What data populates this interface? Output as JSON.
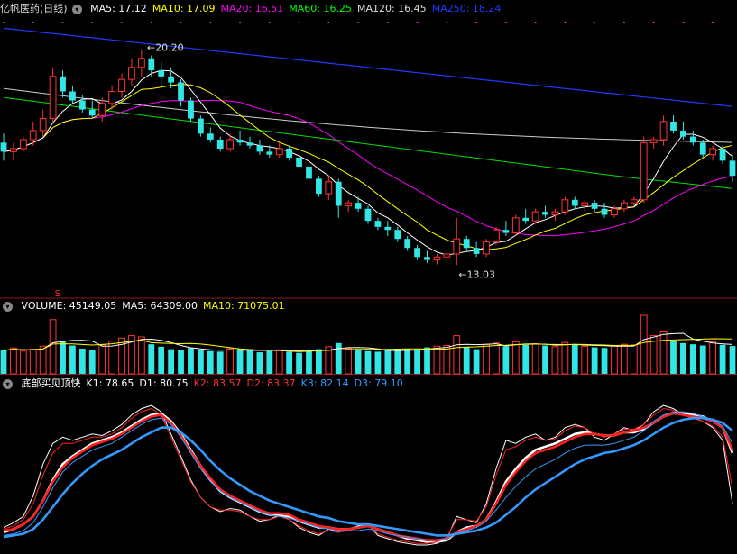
{
  "header1": {
    "title": "亿帆医药(日线)",
    "ma": [
      {
        "label": "MA5: 17.12",
        "color": "#ffffff"
      },
      {
        "label": "MA10: 17.09",
        "color": "#ffff00"
      },
      {
        "label": "MA20: 16.51",
        "color": "#ff00ff"
      },
      {
        "label": "MA60: 16.25",
        "color": "#00ff00"
      },
      {
        "label": "MA120: 16.45",
        "color": "#dddddd"
      },
      {
        "label": "MA250: 18.24",
        "color": "#1e3cff"
      }
    ]
  },
  "header2": {
    "items": [
      {
        "label": "VOLUME: 45149.05",
        "color": "#ffffff"
      },
      {
        "label": "MA5: 64309.00",
        "color": "#ffffff"
      },
      {
        "label": "MA10: 71075.01",
        "color": "#ffff00"
      }
    ]
  },
  "header3": {
    "items": [
      {
        "label": "底部买见顶快",
        "color": "#ffffff"
      },
      {
        "label": "K1: 78.65",
        "color": "#ffffff"
      },
      {
        "label": "D1: 80.75",
        "color": "#ffffff"
      },
      {
        "label": "K2: 83.57",
        "color": "#ff3333"
      },
      {
        "label": "D2: 83.37",
        "color": "#ff3333"
      },
      {
        "label": "K3: 82.14",
        "color": "#3399ff"
      },
      {
        "label": "D3: 79.10",
        "color": "#3399ff"
      }
    ]
  },
  "annotations": {
    "high": "20.20",
    "low": "13.03",
    "signal": "S"
  },
  "chart_data": {
    "type": "candlestick",
    "price_ylim": [
      12.2,
      21.3
    ],
    "bars": 75,
    "high_point": {
      "index": 14,
      "value": 20.2
    },
    "low_point": {
      "index": 46,
      "value": 13.03
    },
    "ohlc": [
      [
        17.1,
        17.4,
        16.5,
        16.8
      ],
      [
        16.8,
        17.1,
        16.5,
        16.9
      ],
      [
        16.9,
        17.3,
        16.8,
        17.2
      ],
      [
        17.2,
        17.8,
        17.0,
        17.5
      ],
      [
        17.5,
        18.2,
        17.3,
        17.9
      ],
      [
        17.9,
        19.6,
        17.8,
        19.3
      ],
      [
        19.3,
        19.5,
        18.6,
        18.8
      ],
      [
        18.8,
        19.0,
        18.4,
        18.5
      ],
      [
        18.5,
        18.7,
        18.1,
        18.2
      ],
      [
        18.2,
        18.5,
        17.9,
        18.0
      ],
      [
        18.0,
        18.6,
        17.8,
        18.4
      ],
      [
        18.4,
        19.0,
        18.2,
        18.8
      ],
      [
        18.8,
        19.4,
        18.6,
        19.2
      ],
      [
        19.2,
        19.9,
        19.0,
        19.6
      ],
      [
        19.6,
        20.2,
        19.3,
        19.9
      ],
      [
        19.9,
        20.0,
        19.3,
        19.5
      ],
      [
        19.5,
        19.8,
        19.0,
        19.3
      ],
      [
        19.3,
        19.6,
        18.9,
        19.1
      ],
      [
        19.1,
        19.2,
        18.3,
        18.5
      ],
      [
        18.5,
        18.6,
        17.8,
        17.9
      ],
      [
        17.9,
        18.0,
        17.3,
        17.4
      ],
      [
        17.4,
        17.6,
        17.1,
        17.2
      ],
      [
        17.2,
        17.3,
        16.8,
        16.9
      ],
      [
        16.9,
        17.4,
        16.8,
        17.2
      ],
      [
        17.2,
        17.5,
        17.0,
        17.1
      ],
      [
        17.1,
        17.3,
        16.9,
        17.0
      ],
      [
        17.0,
        17.2,
        16.7,
        16.8
      ],
      [
        16.8,
        17.0,
        16.6,
        16.7
      ],
      [
        16.7,
        17.1,
        16.6,
        16.9
      ],
      [
        16.9,
        17.0,
        16.5,
        16.6
      ],
      [
        16.6,
        16.7,
        16.2,
        16.3
      ],
      [
        16.3,
        16.4,
        15.8,
        15.9
      ],
      [
        15.9,
        16.0,
        15.3,
        15.4
      ],
      [
        15.4,
        16.0,
        15.2,
        15.8
      ],
      [
        15.8,
        15.9,
        14.6,
        15.0
      ],
      [
        15.0,
        15.2,
        14.8,
        15.1
      ],
      [
        15.1,
        15.3,
        14.8,
        14.9
      ],
      [
        14.9,
        15.0,
        14.4,
        14.5
      ],
      [
        14.5,
        14.6,
        14.2,
        14.3
      ],
      [
        14.3,
        14.5,
        14.0,
        14.2
      ],
      [
        14.2,
        14.3,
        13.8,
        13.9
      ],
      [
        13.9,
        14.0,
        13.5,
        13.6
      ],
      [
        13.6,
        13.7,
        13.2,
        13.3
      ],
      [
        13.3,
        13.5,
        13.1,
        13.2
      ],
      [
        13.2,
        13.4,
        13.05,
        13.3
      ],
      [
        13.3,
        13.5,
        13.1,
        13.4
      ],
      [
        13.4,
        14.6,
        13.03,
        13.9
      ],
      [
        13.9,
        14.0,
        13.5,
        13.6
      ],
      [
        13.6,
        13.8,
        13.3,
        13.4
      ],
      [
        13.4,
        13.9,
        13.3,
        13.8
      ],
      [
        13.8,
        14.3,
        13.7,
        14.2
      ],
      [
        14.2,
        14.5,
        14.0,
        14.1
      ],
      [
        14.1,
        14.7,
        14.0,
        14.6
      ],
      [
        14.6,
        14.9,
        14.4,
        14.5
      ],
      [
        14.5,
        14.9,
        14.4,
        14.8
      ],
      [
        14.8,
        15.0,
        14.6,
        14.7
      ],
      [
        14.7,
        14.9,
        14.5,
        14.8
      ],
      [
        14.8,
        15.3,
        14.7,
        15.2
      ],
      [
        15.2,
        15.3,
        14.9,
        15.0
      ],
      [
        15.0,
        15.2,
        14.8,
        15.1
      ],
      [
        15.1,
        15.2,
        14.8,
        14.9
      ],
      [
        14.9,
        15.1,
        14.6,
        14.7
      ],
      [
        14.7,
        15.0,
        14.6,
        14.9
      ],
      [
        14.9,
        15.2,
        14.8,
        15.1
      ],
      [
        15.1,
        15.3,
        15.0,
        15.2
      ],
      [
        15.2,
        17.3,
        15.1,
        17.1
      ],
      [
        17.1,
        17.3,
        16.9,
        17.2
      ],
      [
        17.2,
        18.0,
        17.0,
        17.8
      ],
      [
        17.8,
        18.0,
        17.4,
        17.5
      ],
      [
        17.5,
        17.8,
        17.2,
        17.3
      ],
      [
        17.3,
        17.5,
        17.0,
        17.1
      ],
      [
        17.1,
        17.2,
        16.6,
        16.7
      ],
      [
        16.7,
        17.0,
        16.5,
        16.9
      ],
      [
        16.9,
        17.0,
        16.4,
        16.5
      ],
      [
        16.5,
        16.7,
        15.8,
        16.0
      ]
    ],
    "volume_ylim": [
      0,
      95000
    ],
    "volume": [
      38000,
      42000,
      37000,
      40000,
      45000,
      88000,
      52000,
      46000,
      41000,
      39000,
      47000,
      53000,
      58000,
      62000,
      60000,
      48000,
      44000,
      40000,
      38000,
      42000,
      39000,
      37000,
      36000,
      41000,
      40000,
      38000,
      35000,
      37000,
      39000,
      36000,
      34000,
      38000,
      40000,
      44000,
      50000,
      41000,
      39000,
      37000,
      36000,
      38000,
      39000,
      41000,
      40000,
      43000,
      45000,
      46000,
      62000,
      44000,
      40000,
      48000,
      50000,
      45000,
      52000,
      47000,
      49000,
      46000,
      44000,
      51000,
      48000,
      45000,
      43000,
      42000,
      46000,
      48000,
      47000,
      95000,
      62000,
      68000,
      54000,
      50000,
      48000,
      46000,
      52000,
      47000,
      45149
    ],
    "kd_ylim": [
      0,
      100
    ],
    "series": [
      {
        "name": "K1",
        "color": "#ffffff",
        "values": [
          15,
          18,
          22,
          35,
          55,
          68,
          72,
          70,
          72,
          74,
          73,
          76,
          80,
          86,
          90,
          92,
          88,
          74,
          60,
          45,
          34,
          28,
          25,
          27,
          26,
          22,
          19,
          20,
          23,
          20,
          15,
          12,
          10,
          14,
          12,
          14,
          16,
          17,
          10,
          8,
          6,
          5,
          4,
          4,
          5,
          8,
          22,
          20,
          18,
          30,
          52,
          70,
          68,
          72,
          74,
          70,
          72,
          78,
          80,
          78,
          72,
          70,
          74,
          78,
          76,
          80,
          88,
          92,
          90,
          86,
          84,
          82,
          78,
          70,
          30
        ]
      },
      {
        "name": "D1",
        "color": "#ffffff",
        "values": [
          12,
          14,
          17,
          22,
          32,
          45,
          55,
          60,
          64,
          68,
          70,
          72,
          75,
          79,
          83,
          86,
          87,
          82,
          74,
          64,
          54,
          45,
          38,
          34,
          31,
          28,
          25,
          23,
          23,
          22,
          19,
          17,
          15,
          15,
          14,
          14,
          15,
          16,
          14,
          12,
          10,
          8,
          7,
          6,
          6,
          7,
          12,
          15,
          16,
          20,
          31,
          44,
          52,
          59,
          64,
          66,
          68,
          71,
          74,
          75,
          74,
          73,
          73,
          75,
          75,
          77,
          81,
          85,
          87,
          87,
          86,
          85,
          82,
          78,
          62
        ]
      },
      {
        "name": "K2",
        "color": "#ff2020",
        "values": [
          14,
          16,
          20,
          30,
          48,
          62,
          68,
          68,
          70,
          72,
          72,
          74,
          78,
          84,
          88,
          90,
          86,
          72,
          58,
          44,
          34,
          28,
          26,
          26,
          25,
          22,
          20,
          20,
          22,
          20,
          16,
          13,
          11,
          13,
          12,
          13,
          15,
          16,
          11,
          9,
          7,
          6,
          5,
          5,
          6,
          9,
          20,
          20,
          19,
          28,
          48,
          64,
          66,
          70,
          72,
          70,
          71,
          76,
          79,
          78,
          74,
          72,
          74,
          77,
          77,
          80,
          86,
          90,
          89,
          86,
          84,
          82,
          79,
          72,
          40
        ]
      },
      {
        "name": "D2",
        "color": "#ff2020",
        "values": [
          13,
          14,
          17,
          22,
          32,
          44,
          53,
          59,
          63,
          67,
          69,
          71,
          74,
          78,
          82,
          85,
          86,
          81,
          73,
          63,
          54,
          46,
          39,
          35,
          32,
          29,
          26,
          24,
          24,
          23,
          20,
          18,
          16,
          15,
          14,
          14,
          15,
          16,
          14,
          12,
          10,
          9,
          8,
          7,
          7,
          8,
          12,
          14,
          16,
          20,
          30,
          42,
          50,
          57,
          62,
          64,
          66,
          69,
          72,
          74,
          74,
          73,
          73,
          75,
          76,
          78,
          81,
          85,
          87,
          86,
          85,
          84,
          82,
          78,
          64
        ]
      },
      {
        "name": "K3",
        "color": "#3399ff",
        "values": [
          10,
          11,
          13,
          18,
          28,
          40,
          50,
          56,
          60,
          64,
          66,
          68,
          72,
          76,
          80,
          83,
          84,
          80,
          72,
          62,
          52,
          44,
          38,
          34,
          31,
          28,
          25,
          23,
          22,
          21,
          19,
          17,
          15,
          14,
          13,
          13,
          13,
          14,
          13,
          11,
          10,
          9,
          8,
          7,
          7,
          8,
          11,
          13,
          15,
          19,
          26,
          34,
          41,
          47,
          52,
          55,
          58,
          62,
          65,
          67,
          67,
          67,
          68,
          70,
          72,
          76,
          82,
          86,
          88,
          88,
          87,
          85,
          83,
          79,
          68
        ]
      },
      {
        "name": "D3",
        "color": "#3399ff",
        "values": [
          9,
          10,
          11,
          14,
          20,
          28,
          36,
          43,
          49,
          54,
          58,
          61,
          64,
          68,
          72,
          75,
          78,
          78,
          75,
          70,
          64,
          57,
          51,
          46,
          42,
          38,
          35,
          32,
          30,
          28,
          26,
          24,
          22,
          21,
          19,
          18,
          17,
          17,
          16,
          15,
          14,
          13,
          12,
          11,
          10,
          10,
          11,
          12,
          13,
          15,
          18,
          23,
          28,
          34,
          39,
          43,
          47,
          51,
          55,
          58,
          60,
          62,
          63,
          65,
          67,
          70,
          74,
          78,
          81,
          83,
          84,
          84,
          83,
          81,
          76
        ]
      }
    ]
  }
}
